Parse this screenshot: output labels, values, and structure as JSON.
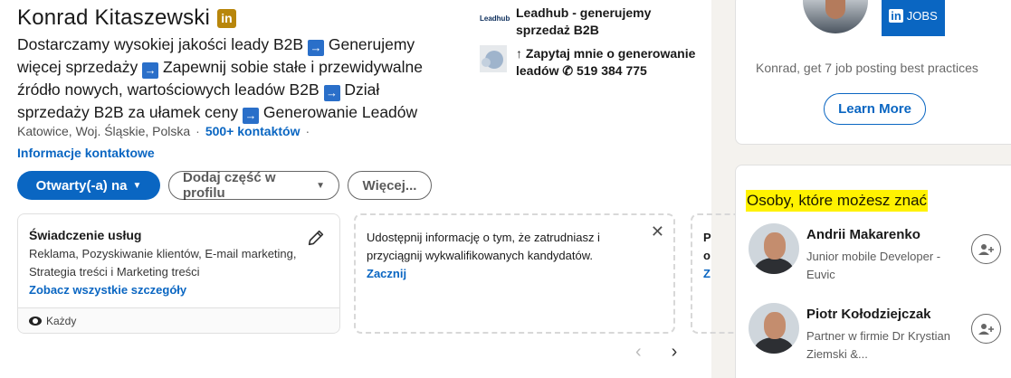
{
  "profile": {
    "name": "Konrad Kitaszewski",
    "badge": "in",
    "headline_parts": [
      "Dostarczamy wysokiej jakości leady B2B",
      "Generujemy więcej sprzedaży",
      "Zapewnij sobie stałe i przewidywalne źródło nowych, wartościowych leadów B2B",
      "Dział sprzedaży B2B za ułamek ceny",
      "Generowanie Leadów"
    ],
    "arrow_glyph": "→",
    "location": "Katowice, Woj. Śląskie, Polska",
    "separator": "·",
    "contacts": "500+ kontaktów",
    "contact_info": "Informacje kontaktowe"
  },
  "buttons": {
    "open_to": "Otwarty(-a) na",
    "add_section": "Dodaj część w profilu",
    "more": "Więcej..."
  },
  "experience": {
    "company_logo": "Leadhub",
    "company": "Leadhub - generujemy sprzedaż B2B",
    "school": "↑ Zapytaj mnie o generowanie leadów ✆ 519 384 775"
  },
  "cards": {
    "services": {
      "title": "Świadczenie usług",
      "desc": "Reklama, Pozyskiwanie klientów, E-mail marketing, Strategia treści i Marketing treści",
      "link": "Zobacz wszystkie szczegóły",
      "visibility": "Każdy"
    },
    "hire": {
      "text": "Udostępnij informację o tym, że zatrudniasz i przyciągnij wykwalifikowanych kandydatów.",
      "start": "Zacznij",
      "close": "✕"
    },
    "partial": {
      "line1": "P",
      "line2": "o",
      "line3": "Z"
    },
    "nav_prev": "‹",
    "nav_next": "›"
  },
  "aside": {
    "jobs_in": "in",
    "jobs_label": "JOBS",
    "promo_text": "Konrad, get 7 job posting best practices",
    "learn_more": "Learn More",
    "pymk_title": "Osoby, które możesz znać",
    "people": [
      {
        "name": "Andrii Makarenko",
        "role": "Junior mobile Developer - Euvic"
      },
      {
        "name": "Piotr Kołodziejczak",
        "role": "Partner w firmie Dr Krystian Ziemski &..."
      }
    ],
    "connect_icon": "+"
  },
  "colors": {
    "accent": "#0a66c2",
    "highlight": "#fff200",
    "badge": "#b8860b"
  }
}
